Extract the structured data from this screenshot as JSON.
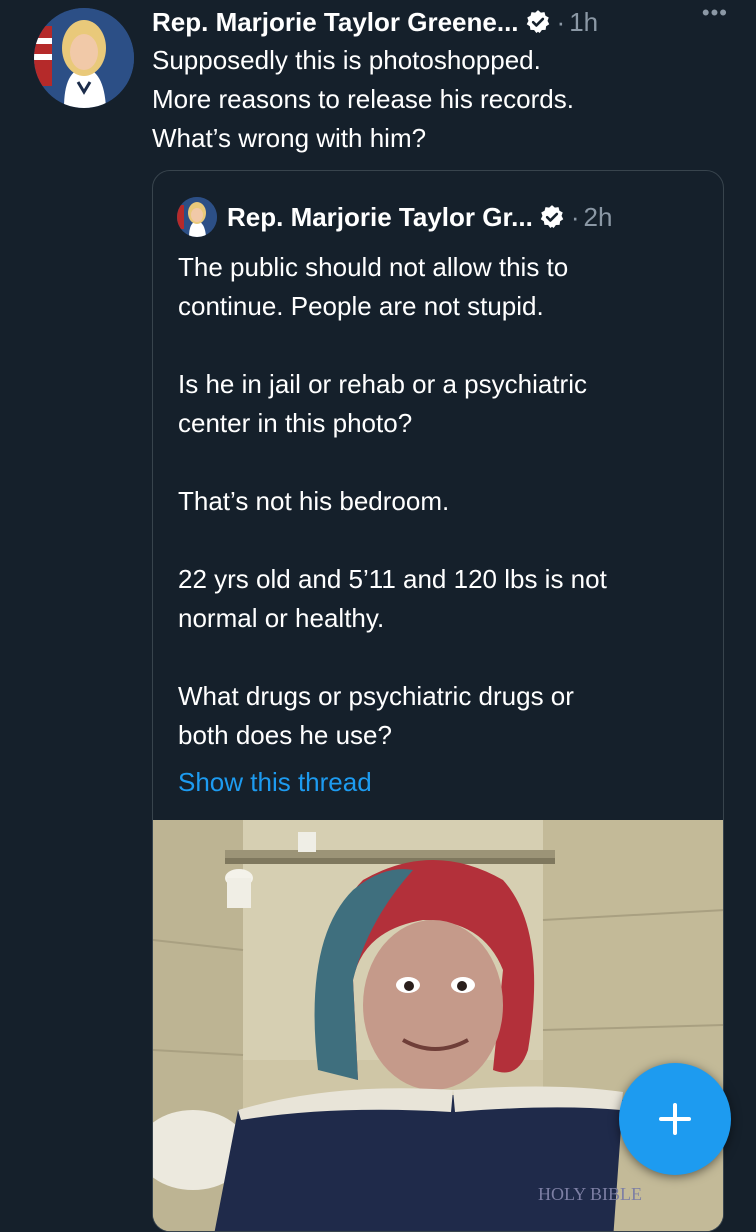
{
  "tweet": {
    "author": "Rep. Marjorie Taylor Greene...",
    "separator": "·",
    "time": "1h",
    "more": "•••",
    "lines": [
      "Supposedly this is photoshopped.",
      "More reasons to release his records.",
      "What’s wrong with him?"
    ]
  },
  "quoted": {
    "author": "Rep. Marjorie Taylor Gr...",
    "separator": "·",
    "time": "2h",
    "lines": [
      "The public should not allow this to",
      "continue. People are not stupid.",
      "",
      "Is he in jail or rehab or a psychiatric",
      "center in this photo?",
      "",
      "That’s not his bedroom.",
      "",
      "22 yrs old and 5’11 and 120 lbs is not",
      "normal or healthy.",
      "",
      "What drugs or psychiatric drugs or",
      "both does he use?"
    ],
    "show_thread": "Show this thread",
    "book_label": "HOLY BIBLE"
  },
  "compose_button": {
    "icon": "plus-icon"
  },
  "colors": {
    "background": "#15202b",
    "accent": "#1d9bf0",
    "secondary_text": "#8b98a5",
    "border": "#38444d"
  }
}
